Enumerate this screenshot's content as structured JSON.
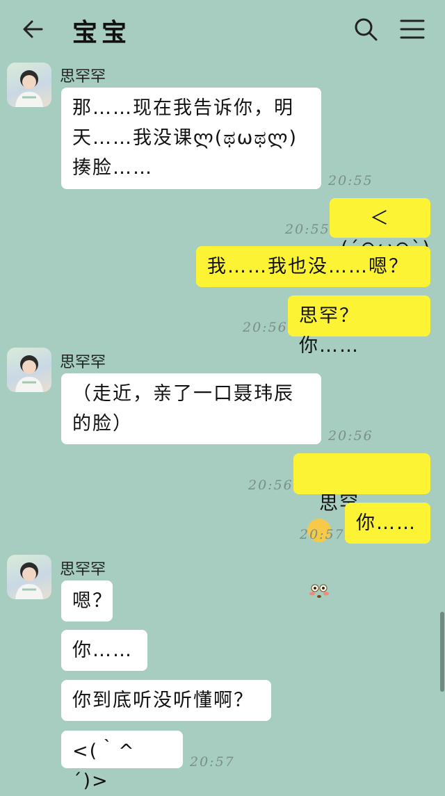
{
  "header": {
    "title": "宝宝",
    "back_icon": "arrow-left-icon",
    "search_icon": "search-icon",
    "menu_icon": "hamburger-menu-icon"
  },
  "messages": [
    {
      "side": "in",
      "sender": "思罕罕",
      "text": "那……现在我告诉你，明天……我没课ლ(ಥωಥლ)揍脸……",
      "time": "20:55"
    },
    {
      "side": "out",
      "text": "＜(´⊙ω⊙`)＞",
      "time": "20:55"
    },
    {
      "side": "out",
      "text": "我……我也没……嗯？",
      "time": ""
    },
    {
      "side": "out",
      "text": "思罕？你……",
      "time": "20:56"
    },
    {
      "side": "in",
      "sender": "思罕罕",
      "text": "（走近，亲了一口聂玮辰的脸）",
      "time": "20:56"
    },
    {
      "side": "out",
      "text": "思罕……",
      "emoji": "flushed-face",
      "time": "20:56"
    },
    {
      "side": "out",
      "text": "你……",
      "time": "20:57"
    },
    {
      "side": "in",
      "sender": "思罕罕",
      "text": "嗯？",
      "time": ""
    },
    {
      "side": "in",
      "text": "你……",
      "time": ""
    },
    {
      "side": "in",
      "text": "你到底听没听懂啊？",
      "time": ""
    },
    {
      "side": "in",
      "text": "<(｀^´)>",
      "time": "20:57"
    }
  ],
  "colors": {
    "background": "#a6cdbf",
    "incoming_bubble": "#ffffff",
    "outgoing_bubble": "#fdf335",
    "timestamp": "#7a8f87"
  }
}
